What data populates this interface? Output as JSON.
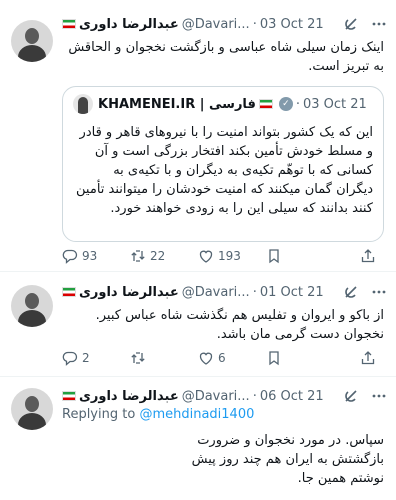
{
  "tweets": [
    {
      "name": "عبدالرضا داوری",
      "handle": "@Davari...",
      "date": "03 Oct 21",
      "text": "اینک زمان سیلی شاه عباسی و بازگشت نخجوان و الحاقش به تبریز است.",
      "quote": {
        "name": "KHAMENEI.IR | فارسی",
        "date": "03 Oct 21",
        "text": "این که یک کشور بتواند امنیت را با نیروهای قاهر و قادر و مسلط خودش تأمین بکند افتخار بزرگی است و آن کسانی که با توهّم تکیه‌ی به دیگران و با تکیه‌ی به دیگران گمان میکنند که امنیت خودشان را میتوانند تأمین کنند بدانند که سیلی این را به زودی خواهند خورد."
      },
      "stats": {
        "replies": "93",
        "retweets": "22",
        "likes": "193"
      }
    },
    {
      "name": "عبدالرضا داوری",
      "handle": "@Davari...",
      "date": "01 Oct 21",
      "text": "از باکو و ایروان و تفلیس هم نگذشت شاه عباس کبیر. نخجوان دست گرمی مان باشد.",
      "stats": {
        "replies": "2",
        "retweets": "",
        "likes": "6"
      }
    },
    {
      "name": "عبدالرضا داوری",
      "handle": "@Davari...",
      "date": "06 Oct 21",
      "replying_prefix": "Replying to",
      "replying_to": "@mehdinadi1400",
      "text": "سپاس. در مورد نخجوان و ضرورت بازگشتش به ایران هم چند روز پیش نوشتم همین جا."
    }
  ],
  "separator": "·"
}
